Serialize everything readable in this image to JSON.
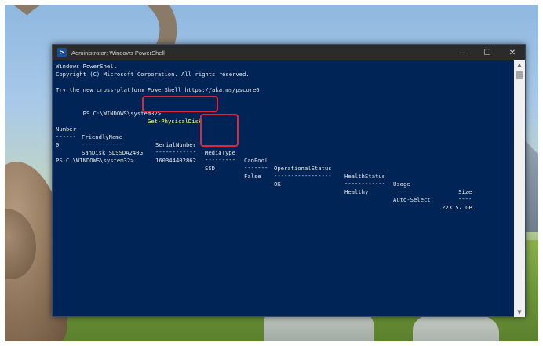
{
  "window": {
    "title": "Administrator: Windows PowerShell",
    "icon": "powershell-icon",
    "controls": {
      "minimize": "—",
      "maximize": "☐",
      "close": "✕"
    }
  },
  "console": {
    "banner1": "Windows PowerShell",
    "banner2": "Copyright (C) Microsoft Corporation. All rights reserved.",
    "banner3": "Try the new cross-platform PowerShell https://aka.ms/pscore6",
    "prompt1": "PS C:\\WINDOWS\\system32>",
    "command": "Get-PhysicalDisk",
    "prompt2": "PS C:\\WINDOWS\\system32>"
  },
  "table": {
    "headers": [
      "Number",
      "FriendlyName",
      "SerialNumber",
      "MediaType",
      "CanPool",
      "OperationalStatus",
      "HealthStatus",
      "Usage",
      "Size"
    ],
    "separators": [
      "------",
      "------------",
      "------------",
      "---------",
      "-------",
      "-----------------",
      "------------",
      "-----",
      "----"
    ],
    "row": [
      "0",
      "SanDisk SDSSDA240G",
      "160344402862",
      "SSD",
      "False",
      "OK",
      "Healthy",
      "Auto-Select",
      "223.57 GB"
    ]
  },
  "colors": {
    "console_bg": "#012456",
    "console_text": "#e6e6e6",
    "command_text": "#ffff5a",
    "highlight": "#e0263a"
  }
}
